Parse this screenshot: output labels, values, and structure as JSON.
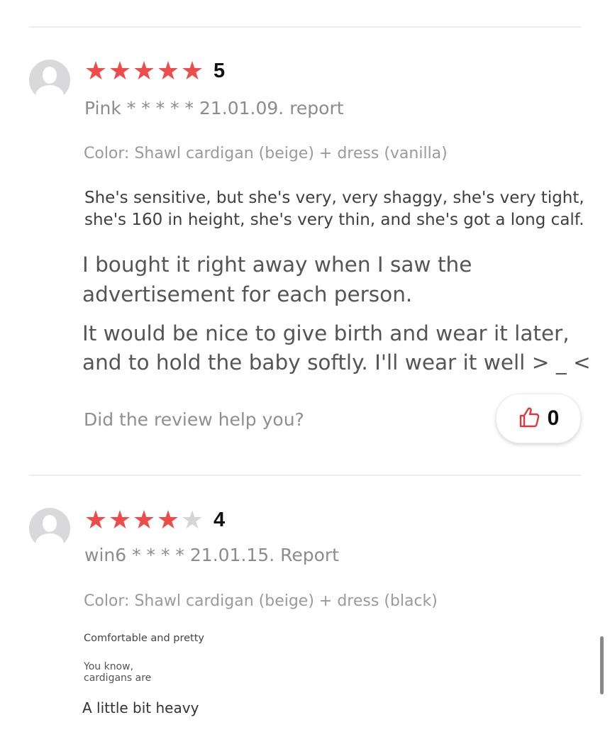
{
  "reviews": [
    {
      "rating": 5,
      "score_label": "5",
      "meta": "Pink * * * * * 21.01.09. report",
      "color_option": "Color: Shawl cardigan (beige) + dress (vanilla)",
      "body_small": [
        "She's sensitive, but she's very, very shaggy, she's very tight,",
        "she's 160 in height, she's very thin, and she's got a long calf."
      ],
      "body_large": [
        "I bought it right away when I saw the",
        "advertisement for each person.",
        "It would be nice to give birth and wear it later,",
        "and to hold the baby softly. I'll wear it well > _ <"
      ],
      "help_question": "Did the review help you?",
      "like_count": "0"
    },
    {
      "rating": 4,
      "score_label": "4",
      "meta": "win6 * * * * 21.01.15. Report",
      "color_option": "Color: Shawl cardigan (beige) + dress (black)",
      "line1": "Comfortable and pretty",
      "line2a": "You know,",
      "line2b": "cardigans are",
      "line3": "A little bit heavy"
    }
  ],
  "icons": {
    "avatar": "user-avatar-icon",
    "star": "star-icon",
    "like": "thumbs-up-icon"
  },
  "colors": {
    "star_active": "#ee4b4b",
    "star_inactive": "#d6d6d6",
    "like_icon": "#d93a3a"
  }
}
